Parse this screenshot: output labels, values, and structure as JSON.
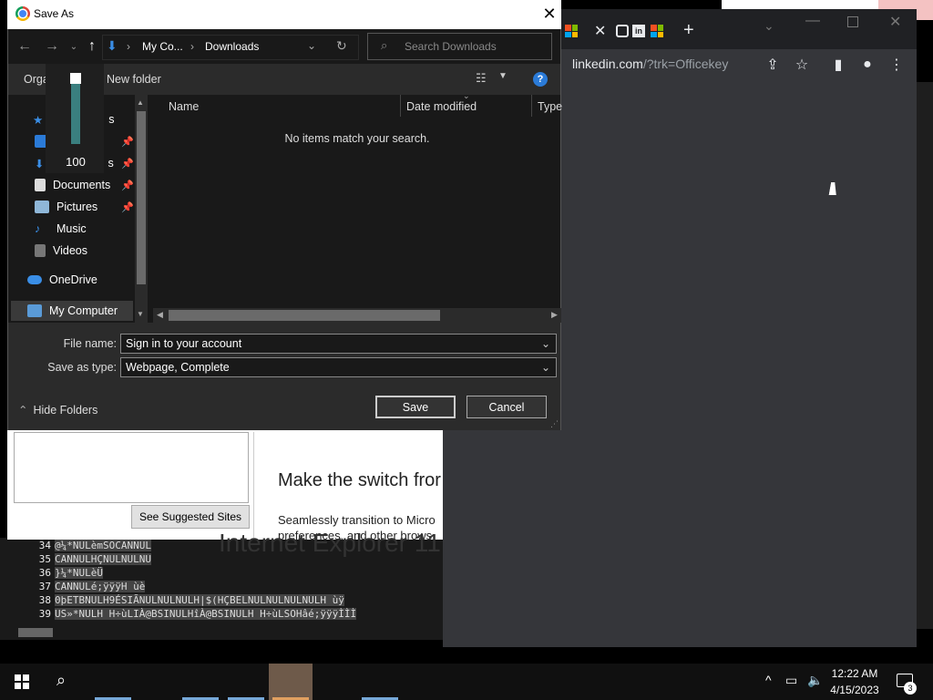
{
  "dialog": {
    "title": "Save As",
    "breadcrumb": [
      "My Co...",
      "Downloads"
    ],
    "search_placeholder": "Search Downloads",
    "organize_label": "Orga",
    "new_folder_label": "New folder",
    "columns": [
      "Name",
      "Date modified",
      "Type"
    ],
    "empty_message": "No items match your search.",
    "nav_items": [
      {
        "label": "s",
        "icon": "star-icon",
        "pinned": false
      },
      {
        "label": "",
        "icon": "desktop-icon",
        "pinned": true
      },
      {
        "label": "s",
        "icon": "download-icon",
        "pinned": true
      },
      {
        "label": "Documents",
        "icon": "documents-icon",
        "pinned": true
      },
      {
        "label": "Pictures",
        "icon": "pictures-icon",
        "pinned": true
      },
      {
        "label": "Music",
        "icon": "music-icon",
        "pinned": false
      },
      {
        "label": "Videos",
        "icon": "videos-icon",
        "pinned": false
      },
      {
        "label": "OneDrive",
        "icon": "onedrive-icon",
        "pinned": false
      },
      {
        "label": "My Computer",
        "icon": "computer-icon",
        "pinned": false
      }
    ],
    "file_name_label": "File name:",
    "file_name_value": "Sign in to your account",
    "save_type_label": "Save as type:",
    "save_type_value": "Webpage, Complete",
    "hide_folders_label": "Hide Folders",
    "save_button": "Save",
    "cancel_button": "Cancel"
  },
  "volume_popup": {
    "value": "100",
    "level": 1.0
  },
  "browser": {
    "url_main": "linkedin.com",
    "url_path": "/?trk=Officekey"
  },
  "ie_page": {
    "suggested_sites_button": "See Suggested Sites",
    "switch_heading": "Make the switch fror",
    "switch_text": "Seamlessly transition to Micro preferences, and other brows",
    "ie11_title": "Internet Explorer 11 :"
  },
  "editor_rows": [
    {
      "line": "34",
      "text": "@¼*NULèmSOCANNUL"
    },
    {
      "line": "35",
      "text": "CANNULHÇNULNULNU"
    },
    {
      "line": "36",
      "text": "}¼*NULèÜ"
    },
    {
      "line": "37",
      "text": "CANNULé;ÿÿÿH ùè"
    },
    {
      "line": "38",
      "text": "0þETBNULH9ÉSIÃNULNULNULH|$(HÇBELNULNULNULNULH ùÿ"
    },
    {
      "line": "39",
      "text": "US»*NULH H÷ùLIÀ@BSINULHîÀ@BSINULH H÷ùLSOHâé;ÿÿÿÌÌÌ"
    }
  ],
  "taskbar": {
    "time": "12:22 AM",
    "date": "4/15/2023",
    "notification_count": "3"
  }
}
